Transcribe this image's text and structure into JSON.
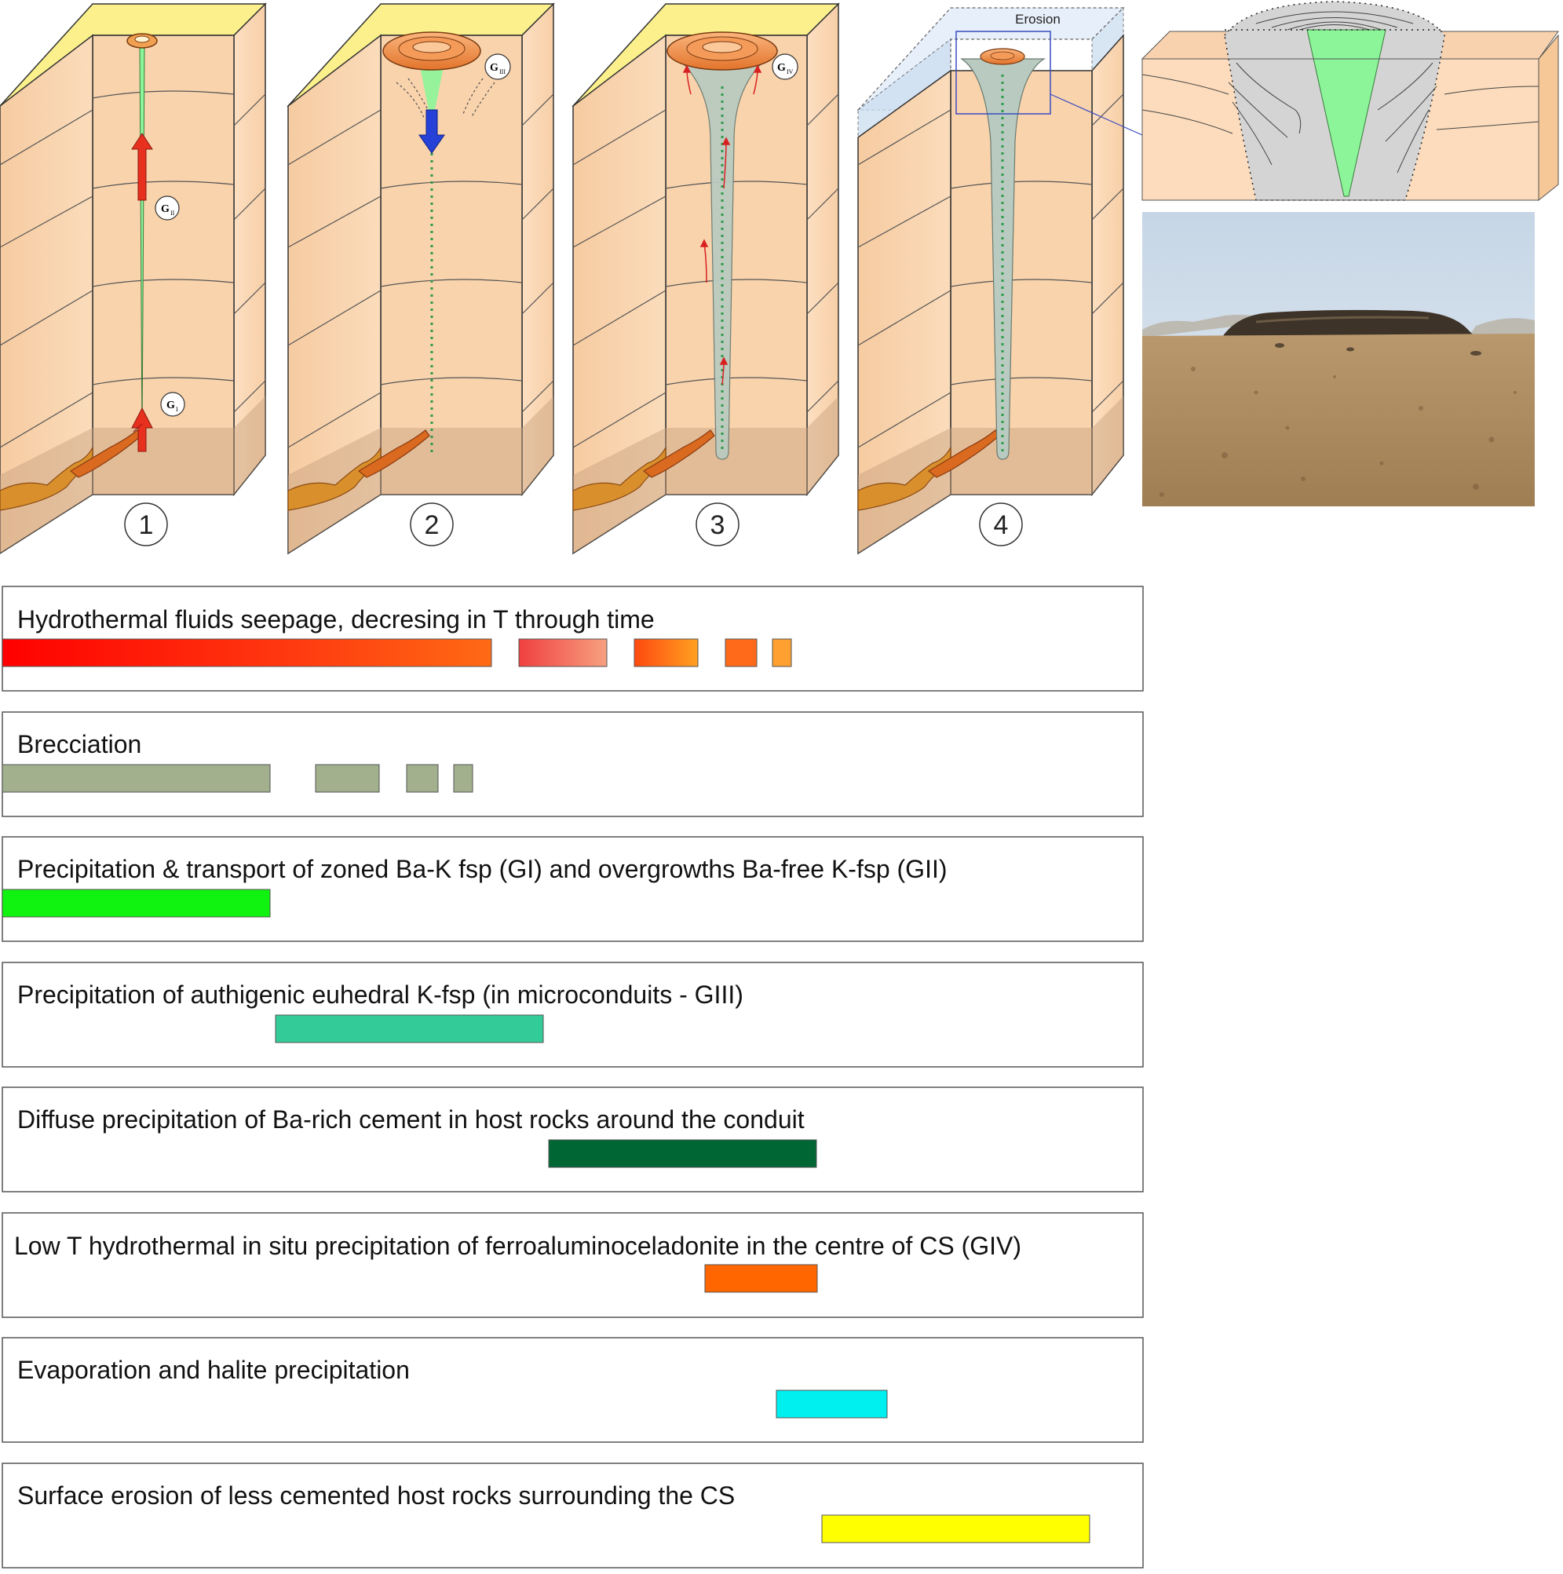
{
  "stages": [
    {
      "number": "1",
      "labels": [
        {
          "main": "G",
          "sub": "I"
        },
        {
          "main": "G",
          "sub": "II"
        }
      ]
    },
    {
      "number": "2",
      "labels": [
        {
          "main": "G",
          "sub": "III"
        }
      ]
    },
    {
      "number": "3",
      "labels": [
        {
          "main": "G",
          "sub": "IV"
        }
      ]
    },
    {
      "number": "4",
      "labels": [],
      "note": "Erosion"
    }
  ],
  "colors": {
    "rock": "#f9d3ac",
    "rock_dark": "#ecc295",
    "surface": "#fbf08c",
    "conduit_green": "#8cf59a",
    "conduit_gray": "#b9cbc0",
    "fluid_arrow": "#e8301e",
    "downflow_arrow": "#2541d8",
    "magma": "#d96a1f"
  },
  "timeline": [
    {
      "label": "Hydrothermal fluids seepage, decresing in T through time",
      "style": "red-orange gradient"
    },
    {
      "label": "Brecciation",
      "color": "#a2b08e"
    },
    {
      "label": "Precipitation & transport of zoned Ba-K fsp (GI) and overgrowths Ba-free K-fsp (GII)",
      "color": "#10f310"
    },
    {
      "label": "Precipitation of authigenic euhedral K-fsp (in microconduits - GIII)",
      "color": "#33cc99"
    },
    {
      "label": "Diffuse precipitation of Ba-rich cement in host rocks around the conduit",
      "color": "#006633"
    },
    {
      "label": "Low T hydrothermal in situ precipitation of ferroaluminoceladonite in the centre of CS (GIV)",
      "color": "#ff6600"
    },
    {
      "label": "Evaporation and halite precipitation",
      "color": "#00f0f0"
    },
    {
      "label": "Surface erosion of less cemented host rocks surrounding the CS",
      "color": "#ffff00"
    }
  ]
}
